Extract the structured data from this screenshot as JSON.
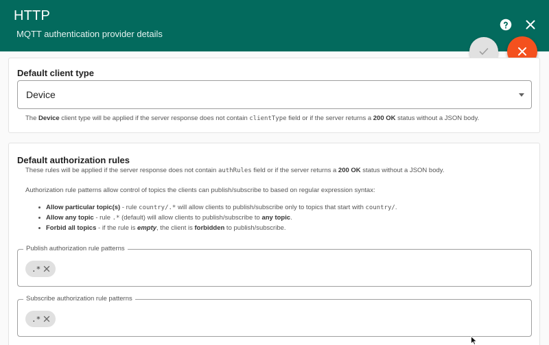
{
  "header": {
    "title": "HTTP",
    "subtitle": "MQTT authentication provider details",
    "help_icon": "help-circle-icon",
    "close_icon": "close-icon"
  },
  "actions": {
    "confirm_icon": "check-icon",
    "cancel_icon": "close-icon"
  },
  "client_type": {
    "title": "Default client type",
    "selected": "Device",
    "hint": {
      "p1": "The ",
      "b1": "Device",
      "p2": " client type will be applied if the server response does not contain ",
      "code": "clientType",
      "p3": " field or if the server returns a ",
      "b2": "200 OK",
      "p4": " status without a JSON body."
    }
  },
  "auth_rules": {
    "title": "Default authorization rules",
    "hint": {
      "p1": "These rules will be applied if the server response does not contain ",
      "code": "authRules",
      "p2": " field or if the server returns a ",
      "b1": "200 OK",
      "p3": " status without a JSON body."
    },
    "intro": "Authorization rule patterns allow control of topics the clients can publish/subscribe to based on regular expression syntax:",
    "bullets": {
      "b1_bold": "Allow particular topic(s)",
      "b1_p1": " - rule ",
      "b1_code1": "country/.*",
      "b1_p2": " will allow clients to publish/subscribe only to topics that start with ",
      "b1_code2": "country/",
      "b1_p3": ".",
      "b2_bold": "Allow any topic",
      "b2_p1": " - rule ",
      "b2_code": ".*",
      "b2_p2": " (default) will allow clients to publish/subscribe to ",
      "b2_bold2": "any topic",
      "b2_p3": ".",
      "b3_bold": "Forbid all topics",
      "b3_p1": " - if the rule is ",
      "b3_em": "empty",
      "b3_p2": ", the client is ",
      "b3_bold2": "forbidden",
      "b3_p3": " to publish/subscribe."
    },
    "publish": {
      "label": "Publish authorization rule patterns",
      "chips": [
        ".*"
      ]
    },
    "subscribe": {
      "label": "Subscribe authorization rule patterns",
      "chips": [
        ".*"
      ]
    }
  },
  "colors": {
    "header_bg": "#036a5d",
    "cancel_fab": "#f4511e",
    "confirm_fab": "#e1e1e1"
  }
}
